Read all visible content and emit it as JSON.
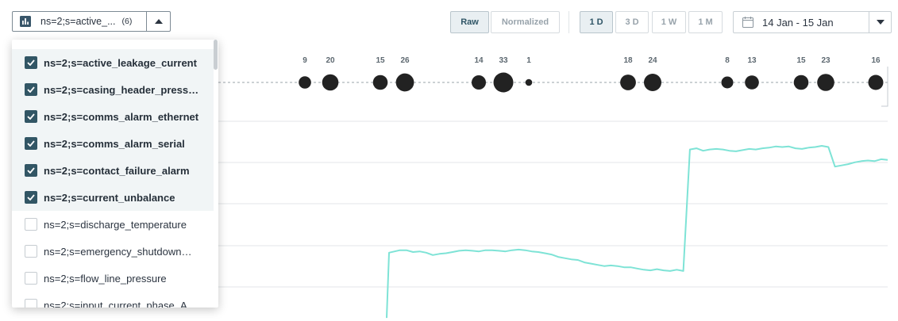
{
  "signal_selector": {
    "label": "ns=2;s=active_...",
    "count": "(6)",
    "icon": "bar-chart-icon",
    "toggle_icon": "caret-up-icon"
  },
  "mode_buttons": [
    {
      "label": "Raw",
      "active": true
    },
    {
      "label": "Normalized",
      "active": false
    }
  ],
  "range_buttons": [
    {
      "label": "1 D",
      "active": true
    },
    {
      "label": "3 D",
      "active": false
    },
    {
      "label": "1 W",
      "active": false
    },
    {
      "label": "1 M",
      "active": false
    }
  ],
  "date_range": {
    "label": "14 Jan - 15 Jan",
    "icon": "calendar-icon",
    "toggle_icon": "caret-down-icon"
  },
  "signal_list": [
    {
      "label": "ns=2;s=active_leakage_current",
      "checked": true
    },
    {
      "label": "ns=2;s=casing_header_press…",
      "checked": true
    },
    {
      "label": "ns=2;s=comms_alarm_ethernet",
      "checked": true
    },
    {
      "label": "ns=2;s=comms_alarm_serial",
      "checked": true
    },
    {
      "label": "ns=2;s=contact_failure_alarm",
      "checked": true
    },
    {
      "label": "ns=2;s=current_unbalance",
      "checked": true
    },
    {
      "label": "ns=2;s=discharge_temperature",
      "checked": false
    },
    {
      "label": "ns=2;s=emergency_shutdown…",
      "checked": false
    },
    {
      "label": "ns=2;s=flow_line_pressure",
      "checked": false
    },
    {
      "label": "ns=2;s=input_current_phase_A",
      "checked": false
    }
  ],
  "chart_data": {
    "type": "scatter+line",
    "events": {
      "counts": [
        9,
        20,
        15,
        26,
        14,
        33,
        1,
        18,
        24,
        8,
        13,
        15,
        23,
        16
      ]
    },
    "series": [
      {
        "color": "#7ee3d6",
        "values": [
          5,
          112,
          116,
          116,
          113,
          114,
          112,
          108,
          110,
          111,
          113,
          115,
          116,
          115,
          114,
          116,
          116,
          115,
          114,
          116,
          117,
          116,
          114,
          113,
          111,
          109,
          105,
          103,
          101,
          100,
          96,
          94,
          92,
          90,
          91,
          90,
          88,
          88,
          86,
          84,
          83,
          85,
          83,
          82,
          84,
          82,
          281,
          283,
          279,
          281,
          282,
          281,
          279,
          278,
          280,
          282,
          281,
          283,
          284,
          286,
          285,
          286,
          283,
          282,
          284,
          285,
          287,
          285,
          253,
          255,
          257,
          260,
          262,
          263,
          262,
          265,
          264
        ]
      }
    ]
  }
}
